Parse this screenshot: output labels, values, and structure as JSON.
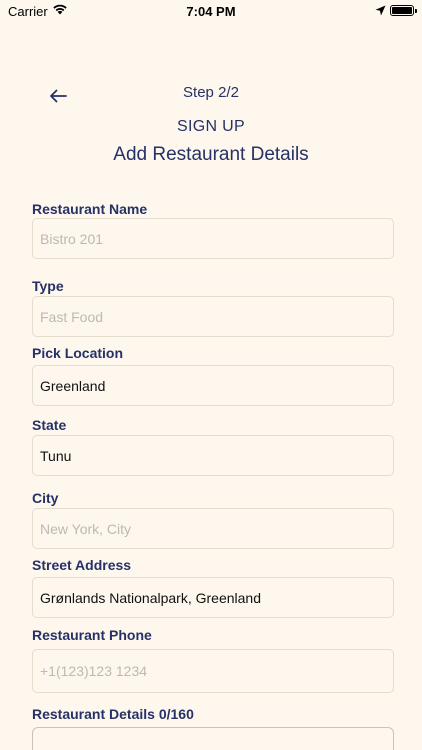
{
  "status_bar": {
    "carrier": "Carrier",
    "time": "7:04 PM"
  },
  "header": {
    "step": "Step 2/2",
    "subtitle": "SIGN UP",
    "title": "Add Restaurant Details"
  },
  "form": {
    "restaurant_name": {
      "label": "Restaurant Name",
      "value": "",
      "placeholder": "Bistro 201"
    },
    "type": {
      "label": "Type",
      "value": "",
      "placeholder": "Fast Food"
    },
    "pick_location": {
      "label": "Pick Location",
      "value": "Greenland",
      "placeholder": ""
    },
    "state": {
      "label": "State",
      "value": "Tunu",
      "placeholder": ""
    },
    "city": {
      "label": "City",
      "value": "",
      "placeholder": "New York, City"
    },
    "street_address": {
      "label": "Street Address",
      "value": "Grønlands Nationalpark, Greenland",
      "placeholder": ""
    },
    "restaurant_phone": {
      "label": "Restaurant Phone",
      "value": "",
      "placeholder": "+1(123)123 1234"
    },
    "restaurant_details": {
      "label": "Restaurant Details 0/160",
      "value": ""
    }
  },
  "icons": {
    "back": "arrow-left-icon",
    "wifi": "wifi-icon",
    "location": "location-arrow-icon",
    "battery": "battery-icon"
  },
  "colors": {
    "background": "#fdf7ee",
    "primary_text": "#263166",
    "placeholder": "#bdbab3",
    "border": "#e4dccd"
  }
}
